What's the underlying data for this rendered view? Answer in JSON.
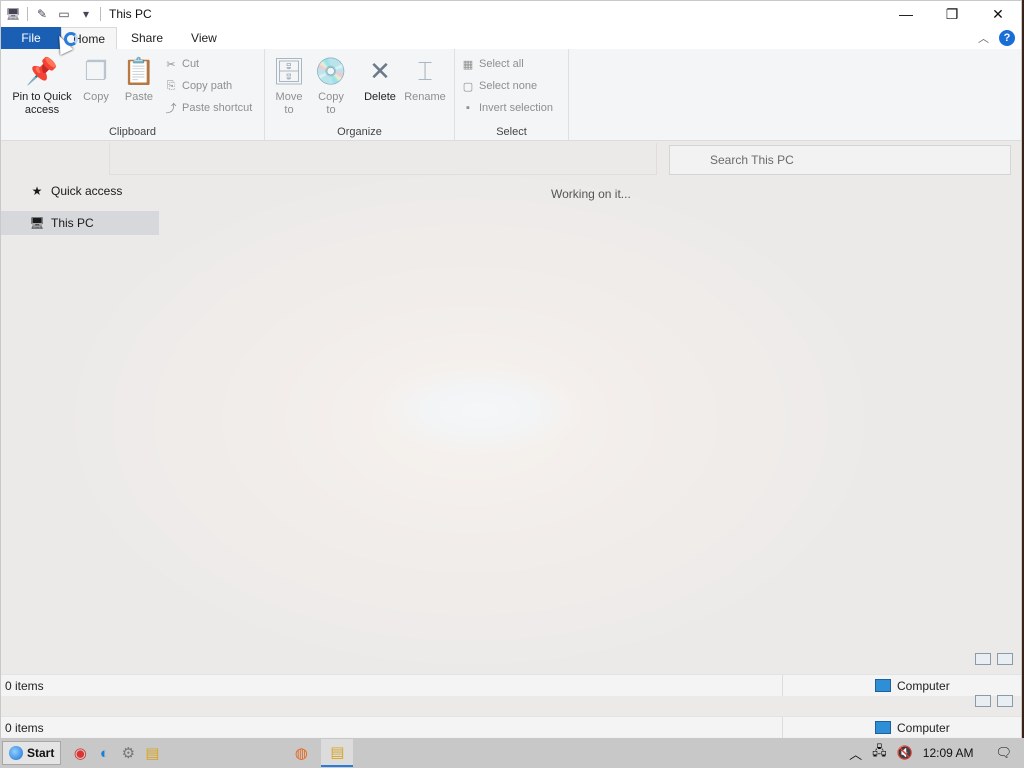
{
  "window": {
    "title": "This PC",
    "controls": {
      "minimize": "—",
      "maximize": "❐",
      "close": "✕"
    }
  },
  "ribbon_tabs": [
    "File",
    "Home",
    "Share",
    "View"
  ],
  "ribbon": {
    "clipboard": {
      "label": "Clipboard",
      "pin": "Pin to Quick access",
      "copy": "Copy",
      "paste": "Paste",
      "cut": "Cut",
      "copy_path": "Copy path",
      "paste_shortcut": "Paste shortcut"
    },
    "organize": {
      "label": "Organize",
      "move_to": "Move to",
      "copy_to": "Copy to",
      "delete": "Delete",
      "rename": "Rename"
    },
    "select": {
      "label": "Select",
      "select_all": "Select all",
      "select_none": "Select none",
      "invert": "Invert selection"
    }
  },
  "search": {
    "placeholder": "Search This PC"
  },
  "nav": [
    {
      "label": "Quick access",
      "icon": "star-icon"
    },
    {
      "label": "This PC",
      "icon": "computer-icon",
      "selected": true
    }
  ],
  "content": {
    "status_text": "Working on it..."
  },
  "statusbar": [
    {
      "items": "0 items",
      "zone": "Computer"
    },
    {
      "items": "0 items",
      "zone": "Computer"
    }
  ],
  "taskbar": {
    "start": "Start",
    "clock": "12:09 AM"
  },
  "colors": {
    "accent": "#1a5fb4",
    "taskbar": "#c8c8c8"
  }
}
